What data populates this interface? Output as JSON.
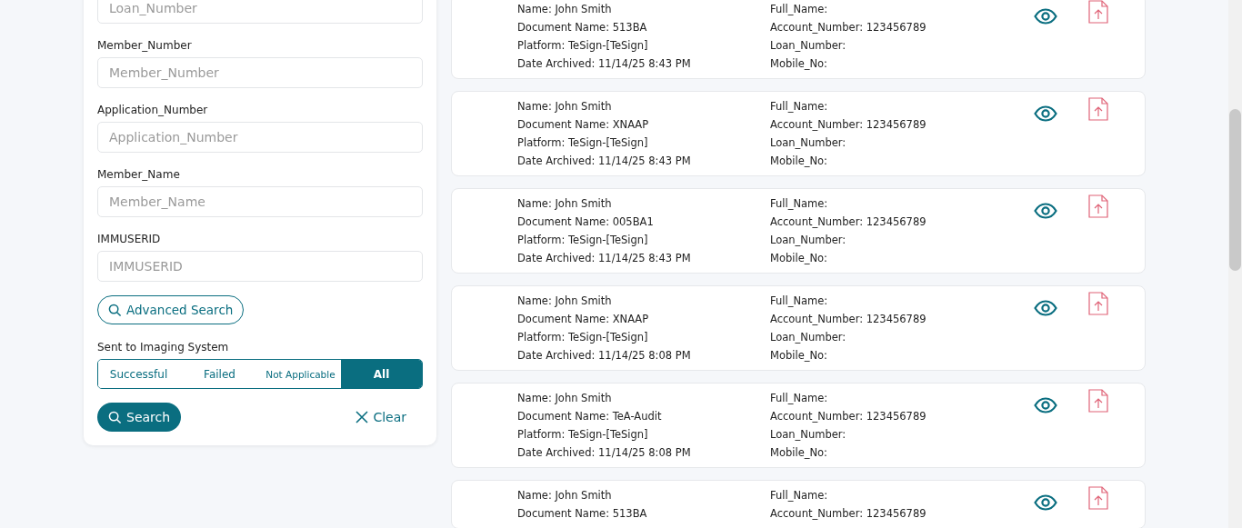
{
  "filters": {
    "fields": [
      {
        "placeholder": "Loan_Number"
      },
      {
        "label": "Member_Number",
        "placeholder": "Member_Number"
      },
      {
        "label": "Application_Number",
        "placeholder": "Application_Number"
      },
      {
        "label": "Member_Name",
        "placeholder": "Member_Name"
      },
      {
        "label": "IMMUSERID",
        "placeholder": "IMMUSERID"
      }
    ],
    "advanced_search": "Advanced Search",
    "imaging": {
      "label": "Sent to Imaging System",
      "options": [
        {
          "label": "Successful",
          "selected": false
        },
        {
          "label": "Failed",
          "selected": false
        },
        {
          "label": "Not Applicable",
          "selected": false
        },
        {
          "label": "All",
          "selected": true
        }
      ]
    },
    "search_button": "Search",
    "clear_button": "Clear"
  },
  "results": [
    {
      "left": [
        "Name: John Smith",
        "Document Name: 513BA",
        "Platform: TeSign-[TeSign]",
        "Date Archived: 11/14/25 8:43 PM"
      ],
      "right": [
        "Full_Name:",
        "Account_Number: 123456789",
        "Loan_Number:",
        "Mobile_No:"
      ]
    },
    {
      "left": [
        "Name: John Smith",
        "Document Name: XNAAP",
        "Platform: TeSign-[TeSign]",
        "Date Archived: 11/14/25 8:43 PM"
      ],
      "right": [
        "Full_Name:",
        "Account_Number: 123456789",
        "Loan_Number:",
        "Mobile_No:"
      ]
    },
    {
      "left": [
        "Name: John Smith",
        "Document Name: 005BA1",
        "Platform: TeSign-[TeSign]",
        "Date Archived: 11/14/25 8:43 PM"
      ],
      "right": [
        "Full_Name:",
        "Account_Number: 123456789",
        "Loan_Number:",
        "Mobile_No:"
      ]
    },
    {
      "left": [
        "Name: John Smith",
        "Document Name: XNAAP",
        "Platform: TeSign-[TeSign]",
        "Date Archived: 11/14/25 8:08 PM"
      ],
      "right": [
        "Full_Name:",
        "Account_Number: 123456789",
        "Loan_Number:",
        "Mobile_No:"
      ]
    },
    {
      "left": [
        "Name: John Smith",
        "Document Name: TeA-Audit",
        "Platform: TeSign-[TeSign]",
        "Date Archived: 11/14/25 8:08 PM"
      ],
      "right": [
        "Full_Name:",
        "Account_Number: 123456789",
        "Loan_Number:",
        "Mobile_No:"
      ]
    },
    {
      "left": [
        "Name: John Smith",
        "Document Name: 513BA"
      ],
      "right": [
        "Full_Name:",
        "Account_Number: 123456789"
      ]
    }
  ]
}
